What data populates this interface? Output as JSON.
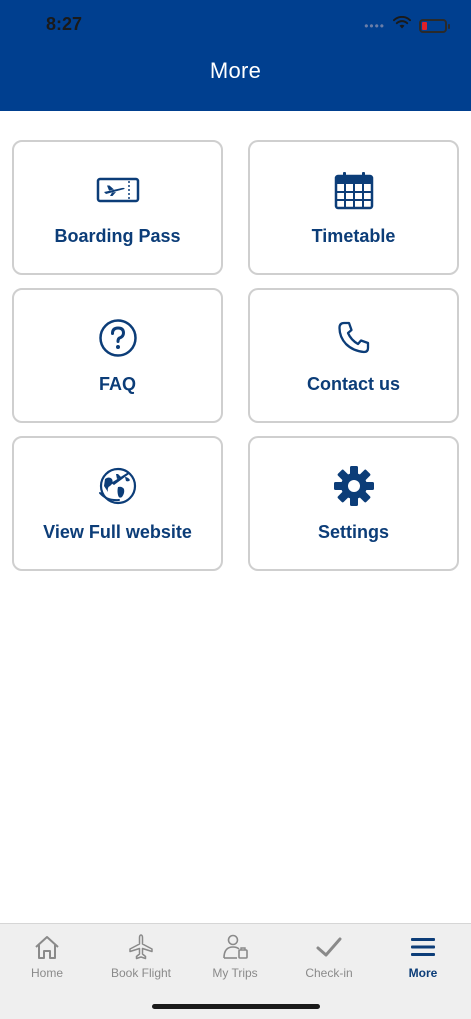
{
  "status_bar": {
    "time": "8:27"
  },
  "header": {
    "title": "More"
  },
  "tiles": [
    {
      "label": "Boarding Pass",
      "icon": "boarding-pass-icon"
    },
    {
      "label": "Timetable",
      "icon": "calendar-icon"
    },
    {
      "label": "FAQ",
      "icon": "question-icon"
    },
    {
      "label": "Contact us",
      "icon": "phone-icon"
    },
    {
      "label": "View Full website",
      "icon": "globe-plane-icon"
    },
    {
      "label": "Settings",
      "icon": "gear-icon"
    }
  ],
  "tabbar": {
    "items": [
      {
        "label": "Home",
        "icon": "home-icon"
      },
      {
        "label": "Book Flight",
        "icon": "airplane-icon"
      },
      {
        "label": "My Trips",
        "icon": "traveler-icon"
      },
      {
        "label": "Check-in",
        "icon": "checkmark-icon"
      },
      {
        "label": "More",
        "icon": "menu-icon",
        "active": true
      }
    ]
  },
  "colors": {
    "brand": "#003F8F",
    "tile_text": "#0C3D78",
    "tab_inactive": "#8A8A8A"
  }
}
